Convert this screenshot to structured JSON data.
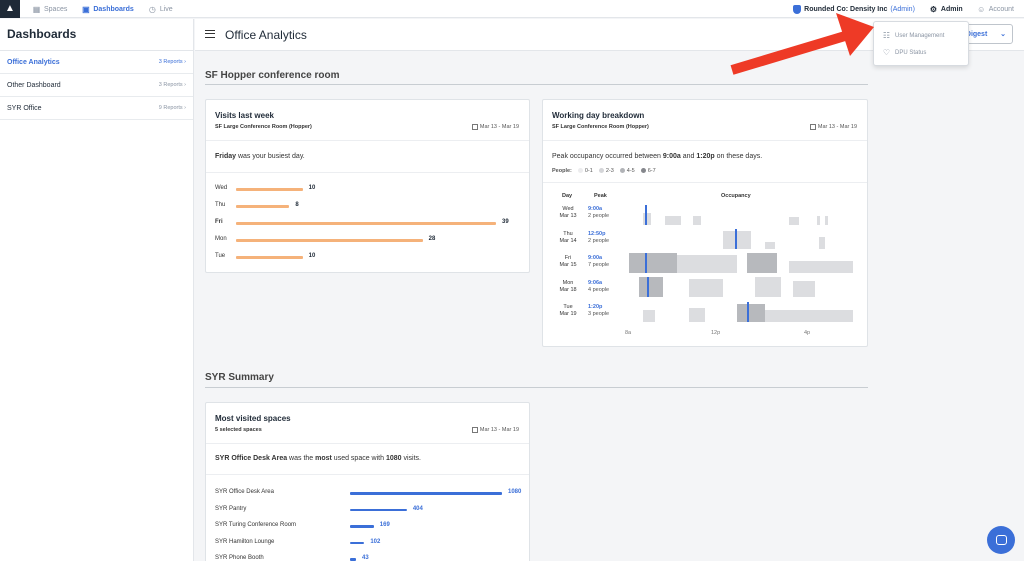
{
  "topnav": {
    "items": [
      {
        "label": "Spaces"
      },
      {
        "label": "Dashboards"
      },
      {
        "label": "Live"
      }
    ],
    "org_name": "Rounded Co: Density Inc",
    "org_role": "(Admin)",
    "admin_label": "Admin",
    "account_label": "Account"
  },
  "dropdown": {
    "items": [
      "User Management",
      "DPU Status"
    ]
  },
  "sidebar": {
    "title": "Dashboards",
    "items": [
      {
        "label": "Office Analytics",
        "count": "3 Reports ›"
      },
      {
        "label": "Other Dashboard",
        "count": "3 Reports ›"
      },
      {
        "label": "SYR Office",
        "count": "9 Reports ›"
      }
    ]
  },
  "header": {
    "title": "Office Analytics",
    "digest_label": "l Digest"
  },
  "sections": [
    {
      "title": "SF Hopper conference room"
    },
    {
      "title": "SYR Summary"
    }
  ],
  "visits_card": {
    "title": "Visits last week",
    "subtitle": "SF Large Conference Room (Hopper)",
    "date_range": "Mar 13 - Mar 19",
    "summary_bold": "Friday",
    "summary_rest": " was your busiest day.",
    "bar_color": "#f5b27a"
  },
  "working_card": {
    "title": "Working day breakdown",
    "subtitle": "SF Large Conference Room (Hopper)",
    "date_range": "Mar 13 - Mar 19",
    "summary_pre": "Peak occupancy occurred between ",
    "summary_t1": "9:00a",
    "summary_mid": " and ",
    "summary_t2": "1:20p",
    "summary_post": " on these days.",
    "legend_label": "People:",
    "legend": [
      "0-1",
      "2-3",
      "4-5",
      "6-7"
    ],
    "col_day": "Day",
    "col_peak": "Peak",
    "col_occ": "Occupancy",
    "rows": [
      {
        "day": "Wed",
        "date": "Mar 13",
        "peak_time": "9:00a",
        "peak_people": "2 people"
      },
      {
        "day": "Thu",
        "date": "Mar 14",
        "peak_time": "12:50p",
        "peak_people": "2 people"
      },
      {
        "day": "Fri",
        "date": "Mar 15",
        "peak_time": "9:00a",
        "peak_people": "7 people"
      },
      {
        "day": "Mon",
        "date": "Mar 18",
        "peak_time": "9:06a",
        "peak_people": "4 people"
      },
      {
        "day": "Tue",
        "date": "Mar 19",
        "peak_time": "1:20p",
        "peak_people": "3 people"
      }
    ],
    "axis_ticks": [
      "8a",
      "12p",
      "4p"
    ]
  },
  "spaces_card": {
    "title": "Most visited spaces",
    "subtitle": "5 selected spaces",
    "date_range": "Mar 13 - Mar 19",
    "summary_bold1": "SYR Office Desk Area",
    "summary_mid": " was the ",
    "summary_bold2": "most",
    "summary_mid2": " used space with ",
    "summary_bold3": "1080",
    "summary_post": " visits.",
    "bar_color": "#3b6fd8"
  },
  "colors": {
    "accent": "#3b6fd8",
    "arrow": "#ee3a26"
  },
  "chart_data": [
    {
      "type": "bar",
      "categories": [
        "Wed",
        "Thu",
        "Fri",
        "Mon",
        "Tue"
      ],
      "values": [
        10,
        8,
        39,
        28,
        10
      ],
      "orientation": "horizontal",
      "highlight": "Fri"
    },
    {
      "type": "bar",
      "categories": [
        "SYR Office Desk Area",
        "SYR Pantry",
        "SYR Turing Conference Room",
        "SYR Hamilton Lounge",
        "SYR Phone Booth"
      ],
      "values": [
        1080,
        404,
        169,
        102,
        43
      ],
      "orientation": "horizontal"
    }
  ]
}
